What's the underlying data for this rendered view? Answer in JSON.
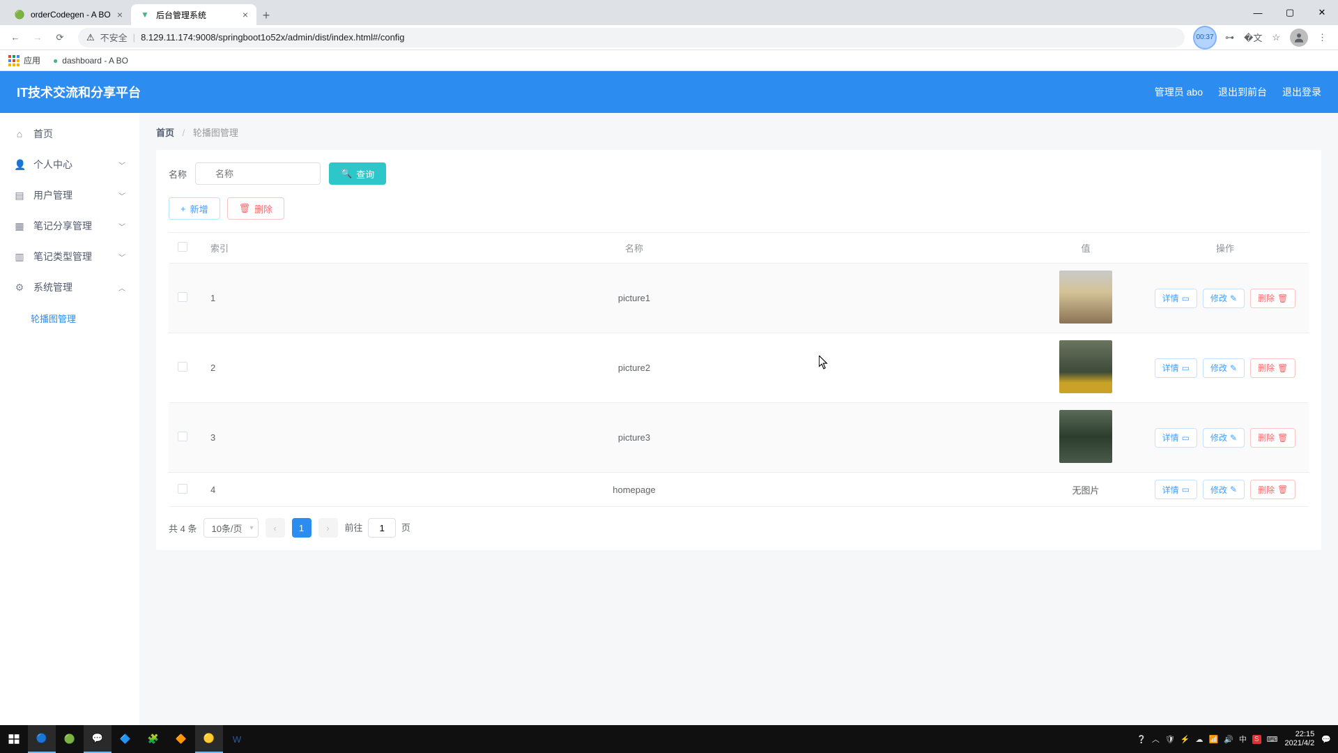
{
  "browser": {
    "tabs": [
      {
        "title": "orderCodegen - A BO",
        "active": false
      },
      {
        "title": "后台管理系统",
        "active": true
      }
    ],
    "insecure_label": "不安全",
    "url": "8.129.11.174:9008/springboot1o52x/admin/dist/index.html#/config",
    "time_badge": "00:37",
    "bookmarks": {
      "apps": "应用",
      "items": [
        "dashboard - A BO"
      ]
    }
  },
  "header": {
    "logo": "IT技术交流和分享平台",
    "user": "管理员 abo",
    "to_front": "退出到前台",
    "logout": "退出登录"
  },
  "sidebar": {
    "items": [
      {
        "icon": "home",
        "label": "首页"
      },
      {
        "icon": "user",
        "label": "个人中心",
        "expandable": true
      },
      {
        "icon": "users",
        "label": "用户管理",
        "expandable": true
      },
      {
        "icon": "notes",
        "label": "笔记分享管理",
        "expandable": true
      },
      {
        "icon": "tags",
        "label": "笔记类型管理",
        "expandable": true
      },
      {
        "icon": "gear",
        "label": "系统管理",
        "expandable": true,
        "expanded": true
      }
    ],
    "sub_item": "轮播图管理"
  },
  "breadcrumb": {
    "home": "首页",
    "current": "轮播图管理"
  },
  "search": {
    "label": "名称",
    "placeholder": "名称",
    "query_btn": "查询"
  },
  "toolbar": {
    "add": "新增",
    "delete": "删除"
  },
  "table": {
    "headers": {
      "index": "索引",
      "name": "名称",
      "value": "值",
      "ops": "操作"
    },
    "no_image": "无图片",
    "rows": [
      {
        "index": "1",
        "name": "picture1",
        "has_image": true
      },
      {
        "index": "2",
        "name": "picture2",
        "has_image": true
      },
      {
        "index": "3",
        "name": "picture3",
        "has_image": true
      },
      {
        "index": "4",
        "name": "homepage",
        "has_image": false
      }
    ],
    "actions": {
      "detail": "详情",
      "edit": "修改",
      "delete": "删除"
    }
  },
  "pagination": {
    "total_label": "共 4 条",
    "page_size": "10条/页",
    "current": "1",
    "jump_prefix": "前往",
    "jump_value": "1",
    "jump_suffix": "页"
  },
  "taskbar": {
    "time": "22:15",
    "date": "2021/4/2",
    "ime": "中"
  }
}
